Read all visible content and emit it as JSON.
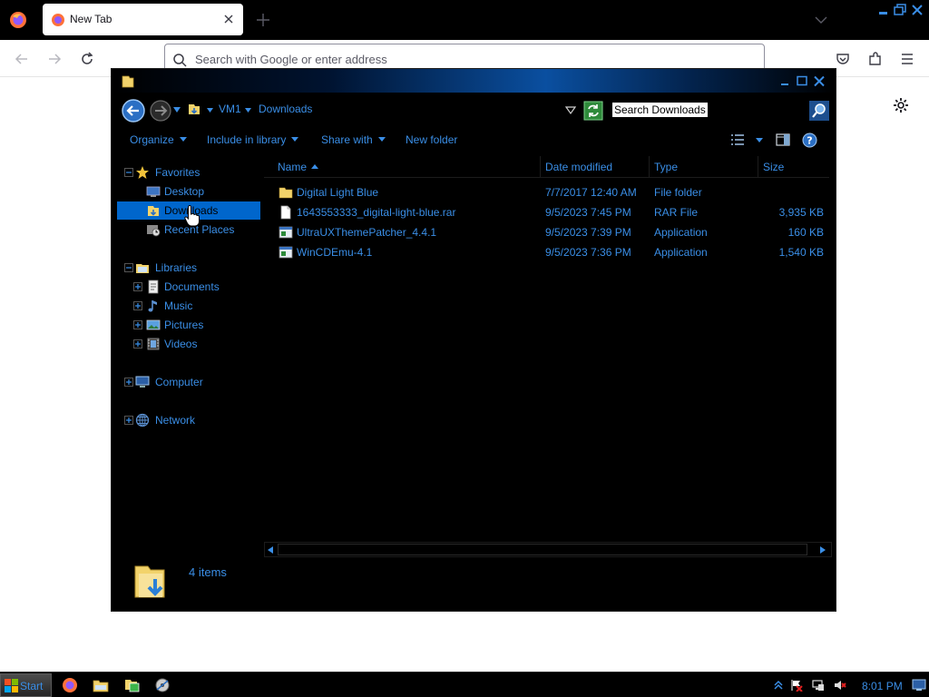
{
  "browser": {
    "tab_title": "New Tab",
    "url_placeholder": "Search with Google or enter address"
  },
  "explorer": {
    "breadcrumb": [
      "VM1",
      "Downloads"
    ],
    "search_placeholder": "Search Downloads",
    "toolbar": {
      "organize": "Organize",
      "include_in_library": "Include in library",
      "share_with": "Share with",
      "new_folder": "New folder"
    },
    "nav": {
      "favorites": "Favorites",
      "desktop": "Desktop",
      "downloads": "Downloads",
      "recent_places": "Recent Places",
      "libraries": "Libraries",
      "documents": "Documents",
      "music": "Music",
      "pictures": "Pictures",
      "videos": "Videos",
      "computer": "Computer",
      "network": "Network"
    },
    "columns": {
      "name": "Name",
      "date_modified": "Date modified",
      "type": "Type",
      "size": "Size"
    },
    "files": [
      {
        "name": "Digital Light Blue",
        "date": "7/7/2017 12:40 AM",
        "type": "File folder",
        "size": "",
        "icon": "folder-icon"
      },
      {
        "name": "1643553333_digital-light-blue.rar",
        "date": "9/5/2023 7:45 PM",
        "type": "RAR File",
        "size": "3,935 KB",
        "icon": "rar-file-icon"
      },
      {
        "name": "UltraUXThemePatcher_4.4.1",
        "date": "9/5/2023 7:39 PM",
        "type": "Application",
        "size": "160 KB",
        "icon": "application-icon"
      },
      {
        "name": "WinCDEmu-4.1",
        "date": "9/5/2023 7:36 PM",
        "type": "Application",
        "size": "1,540 KB",
        "icon": "application-icon"
      }
    ],
    "item_count": "4 items"
  },
  "taskbar": {
    "start_label": "Start",
    "clock": "8:01 PM"
  },
  "colors": {
    "accent": "#3a8ee6",
    "selection": "#0066cc",
    "window_bg": "#000000"
  }
}
